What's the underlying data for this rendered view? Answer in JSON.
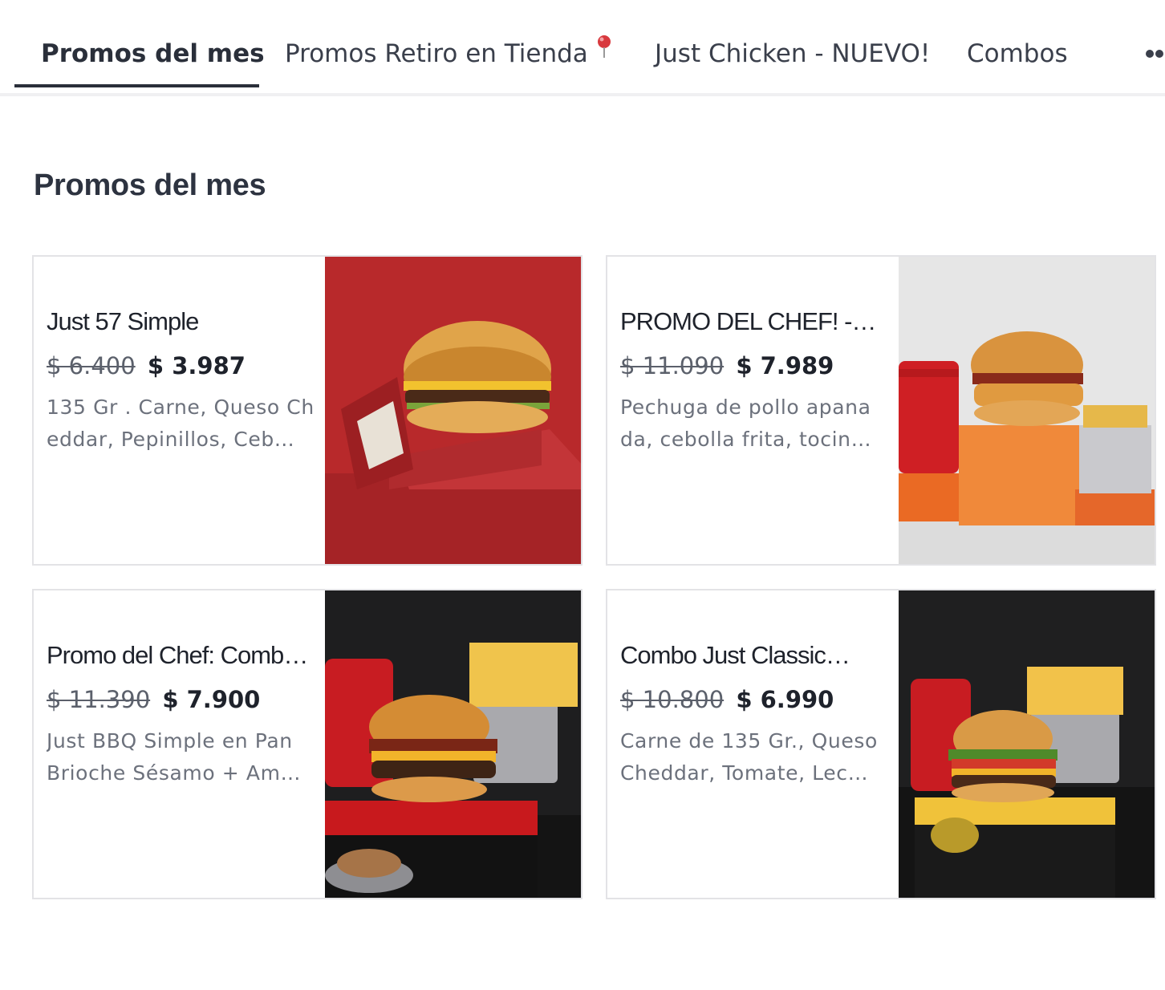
{
  "tabs": [
    {
      "label": "Promos del mes",
      "active": true
    },
    {
      "label": "Promos Retiro en Tienda",
      "icon": "map-pin-icon"
    },
    {
      "label": "Just Chicken - NUEVO!"
    },
    {
      "label": "Combos"
    }
  ],
  "more_icon": "more-dots-icon",
  "section": {
    "title": "Promos del mes"
  },
  "products": [
    {
      "name": "Just 57 Simple",
      "old_price": "$ 6.400",
      "price": "$ 3.987",
      "desc_line1": "135 Gr . Carne, Queso Ch",
      "desc_line2": "eddar, Pepinillos, Ceb…"
    },
    {
      "name": "PROMO DEL CHEF! -…",
      "old_price": "$ 11.090",
      "price": "$ 7.989",
      "desc_line1": "Pechuga de pollo apana",
      "desc_line2": "da, cebolla frita, tocin…"
    },
    {
      "name": "Promo del Chef: Combo…",
      "old_price": "$ 11.390",
      "price": "$ 7.900",
      "desc_line1": "Just BBQ Simple en Pan",
      "desc_line2": "Brioche Sésamo + Am…"
    },
    {
      "name": "Combo Just Classic…",
      "old_price": "$ 10.800",
      "price": "$ 6.990",
      "desc_line1": "Carne de 135 Gr., Queso",
      "desc_line2": "Cheddar, Tomate, Lec…"
    }
  ],
  "colors": {
    "text_dark": "#1e222b",
    "text_muted": "#6c717c",
    "tab_underline": "#2a2f3a"
  }
}
